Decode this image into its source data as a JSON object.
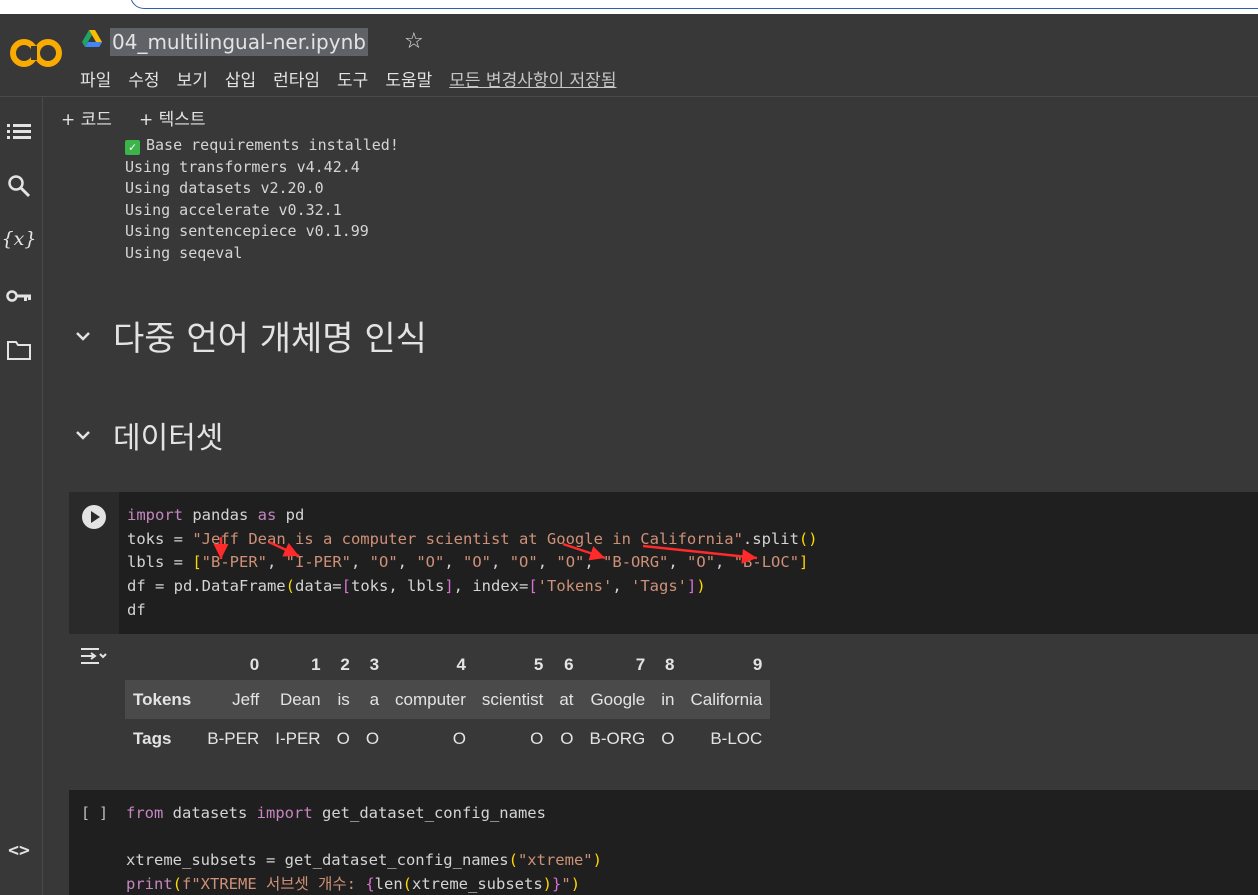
{
  "header": {
    "notebook_title": "04_multilingual-ner.ipynb",
    "menu": [
      "파일",
      "수정",
      "보기",
      "삽입",
      "런타임",
      "도구",
      "도움말"
    ],
    "saved_status": "모든 변경사항이 저장됨"
  },
  "toolbar": {
    "add_code": "코드",
    "add_text": "텍스트"
  },
  "output_lines": [
    "Base requirements installed!",
    "Using transformers v4.42.4",
    "Using datasets v2.20.0",
    "Using accelerate v0.32.1",
    "Using sentencepiece v0.1.99",
    "Using seqeval"
  ],
  "headings": {
    "section1": "다중 언어 개체명 인식",
    "section2": "데이터셋"
  },
  "dataframe": {
    "columns": [
      "0",
      "1",
      "2",
      "3",
      "4",
      "5",
      "6",
      "7",
      "8",
      "9"
    ],
    "rows": [
      {
        "label": "Tokens",
        "cells": [
          "Jeff",
          "Dean",
          "is",
          "a",
          "computer",
          "scientist",
          "at",
          "Google",
          "in",
          "California"
        ]
      },
      {
        "label": "Tags",
        "cells": [
          "B-PER",
          "I-PER",
          "O",
          "O",
          "O",
          "O",
          "O",
          "B-ORG",
          "O",
          "B-LOC"
        ]
      }
    ]
  },
  "cell2": {
    "bracket": "[ ]"
  }
}
